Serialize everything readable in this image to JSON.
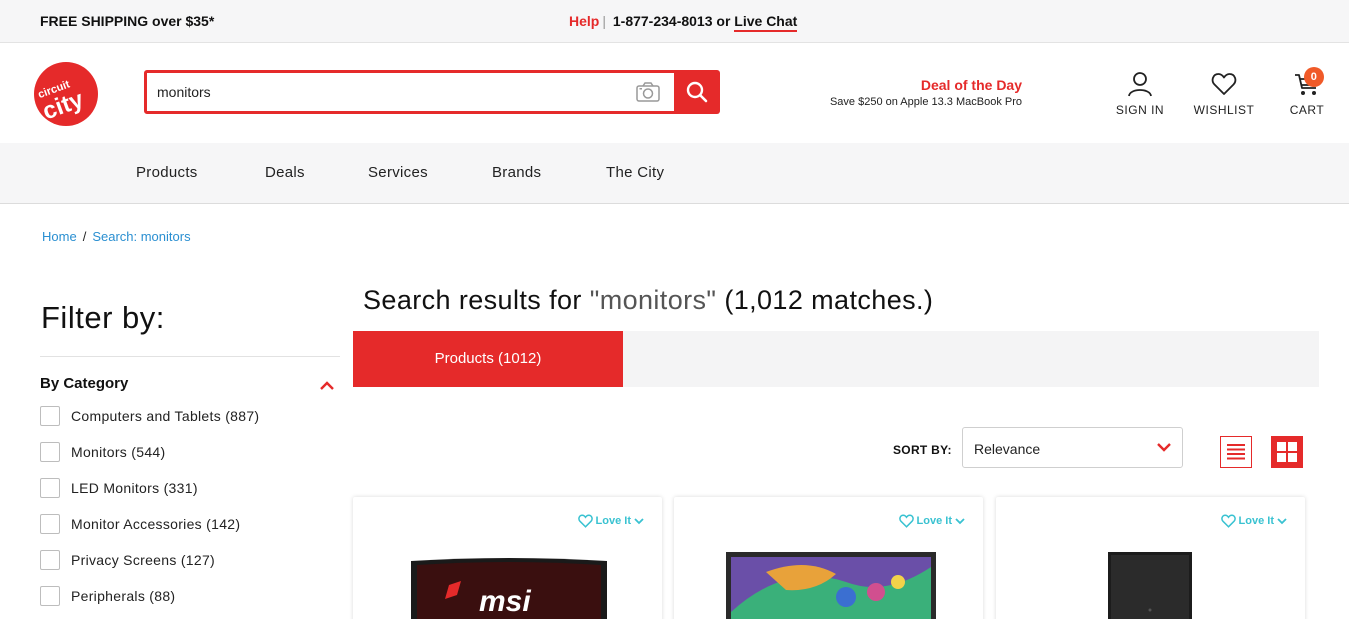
{
  "topbar": {
    "shipping": "FREE SHIPPING over $35*",
    "help": "Help",
    "separator": "|",
    "phone": "1-877-234-8013 or",
    "chat": "Live Chat"
  },
  "header": {
    "logo_text": "circuit city",
    "search_value": "monitors",
    "deal_title": "Deal of the Day",
    "deal_sub": "Save $250 on Apple 13.3 MacBook Pro",
    "signin": "SIGN IN",
    "wishlist": "WISHLIST",
    "cart": "CART",
    "cart_count": "0"
  },
  "nav": [
    "Products",
    "Deals",
    "Services",
    "Brands",
    "The City"
  ],
  "breadcrumb": {
    "home": "Home",
    "separator": "/",
    "current": "Search: monitors"
  },
  "sidebar": {
    "title": "Filter by:",
    "category_heading": "By Category",
    "categories": [
      "Computers and Tablets (887)",
      "Monitors (544)",
      "LED Monitors (331)",
      "Monitor Accessories (142)",
      "Privacy Screens (127)",
      "Peripherals (88)"
    ]
  },
  "results": {
    "title_prefix": "Search results for",
    "query": "\"monitors\"",
    "title_suffix": "(1,012 matches.)",
    "tab_active": "Products (1012)",
    "sort_label": "SORT BY:",
    "sort_value": "Relevance"
  },
  "products": [
    {
      "love": "Love It",
      "brand_mark": "msi"
    },
    {
      "love": "Love It"
    },
    {
      "love": "Love It"
    }
  ],
  "colors": {
    "brand_red": "#e52a2a",
    "link_blue": "#2a8fd1",
    "love_teal": "#39c2d1",
    "cart_badge": "#f05a28"
  }
}
